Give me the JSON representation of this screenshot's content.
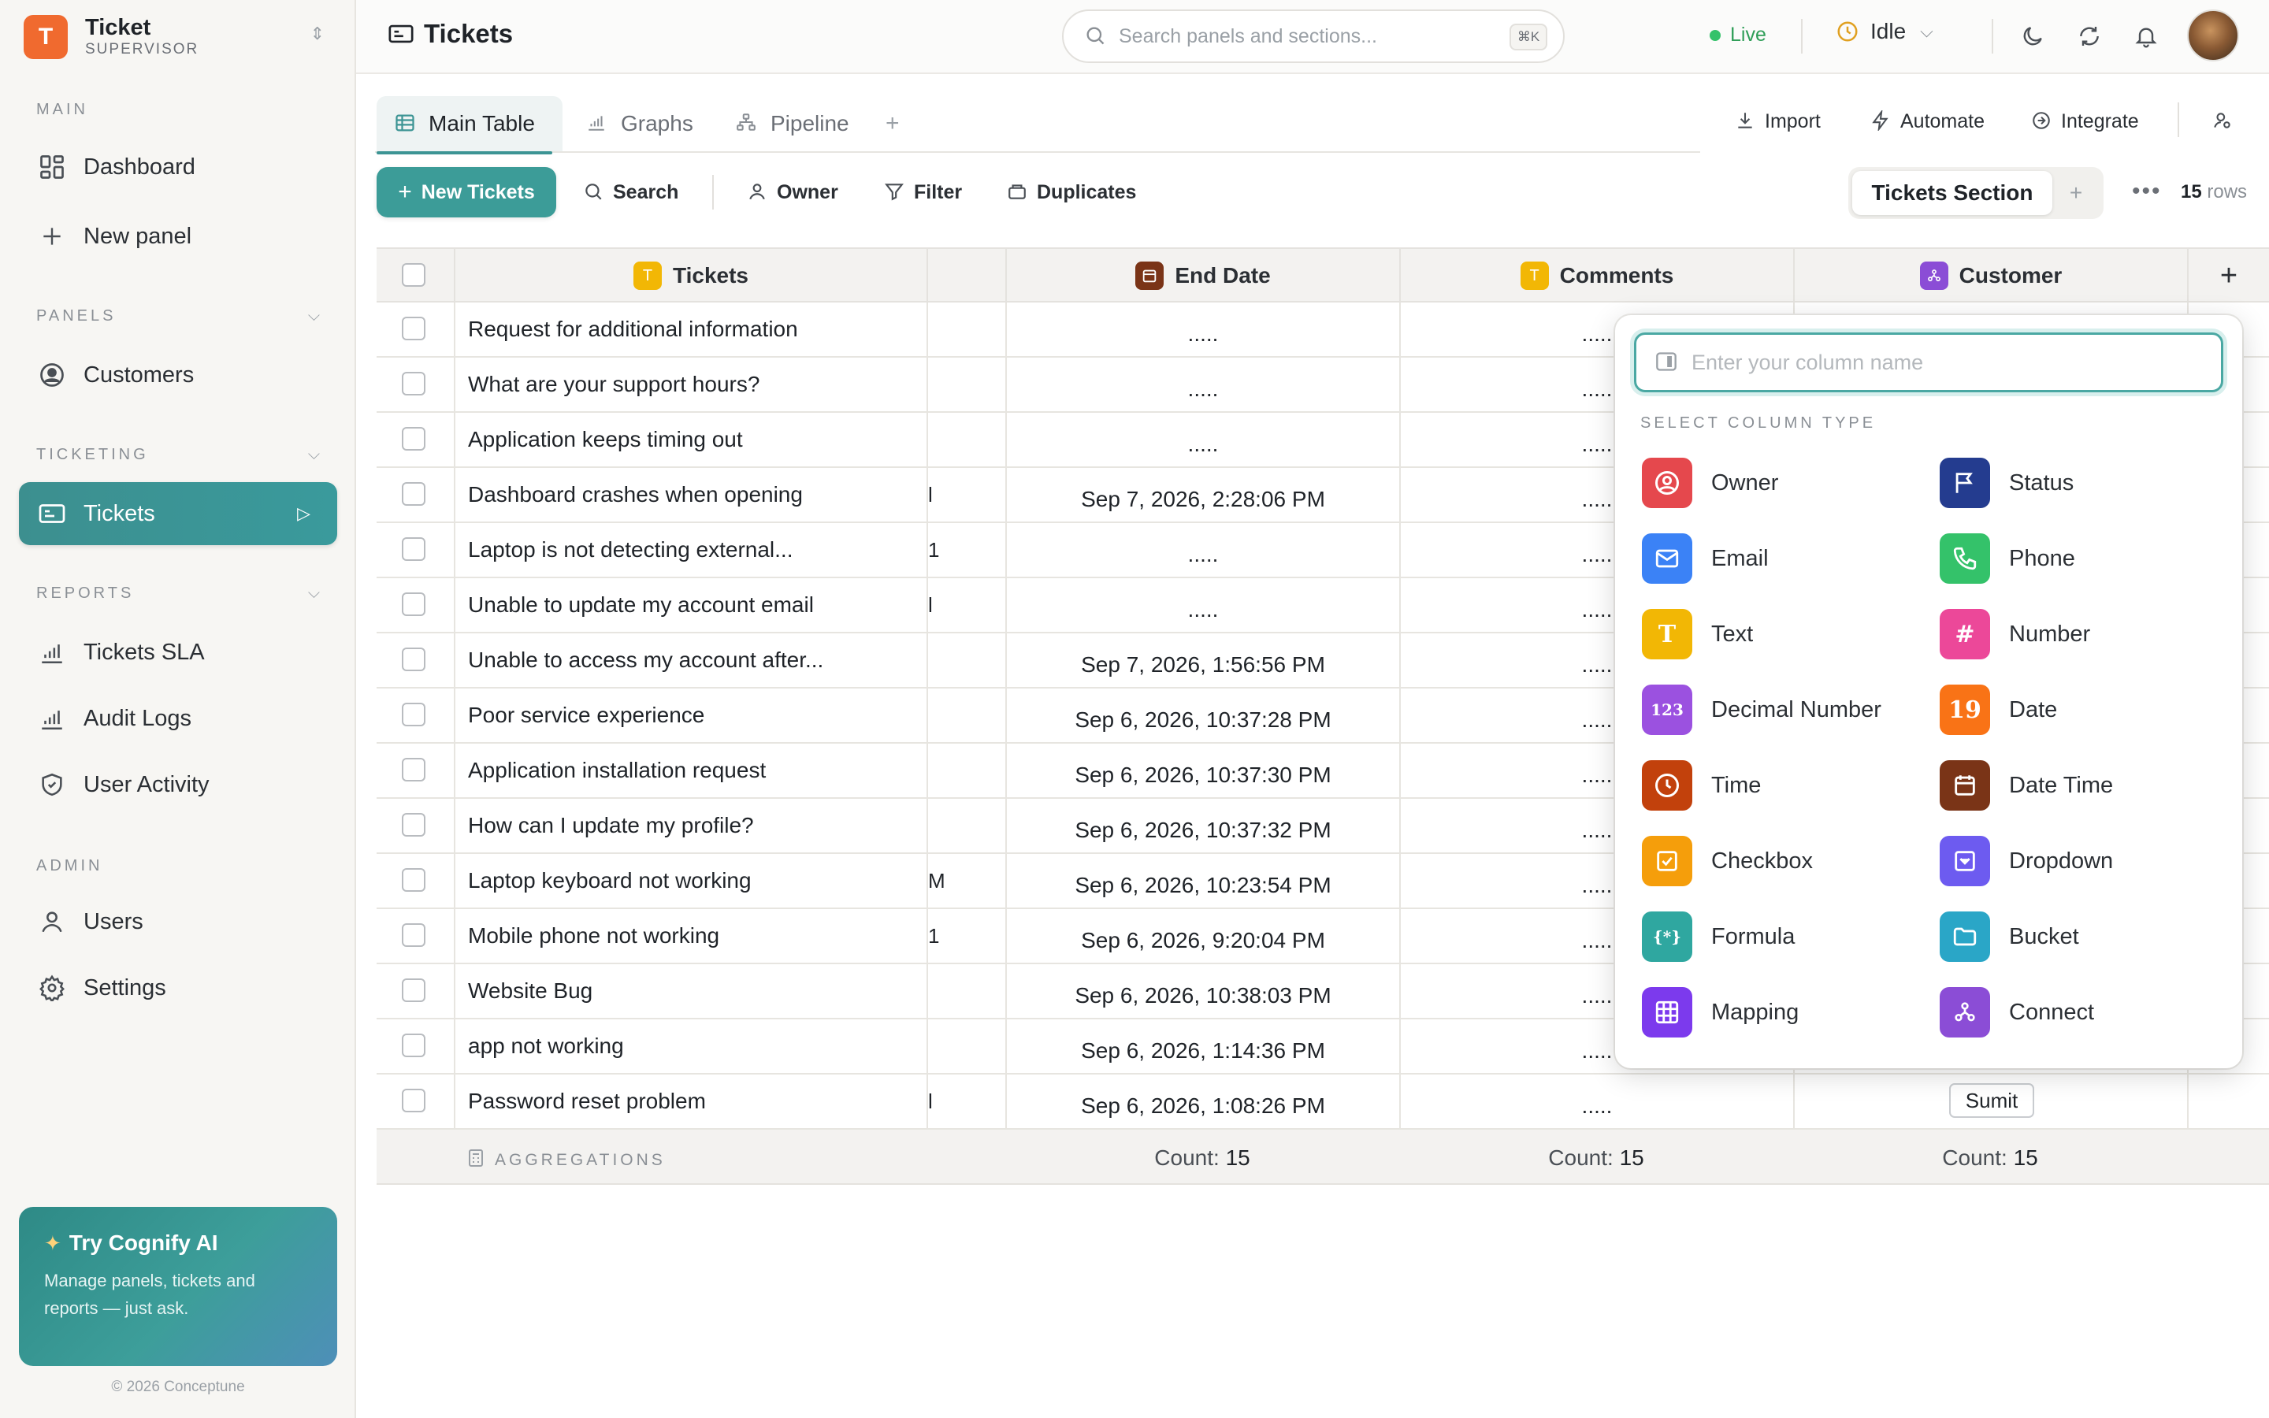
{
  "brand": {
    "logo_letter": "T",
    "title": "Ticket",
    "subtitle": "SUPERVISOR"
  },
  "sidebar": {
    "main_label": "MAIN",
    "main_items": [
      {
        "label": "Dashboard"
      },
      {
        "label": "New panel"
      }
    ],
    "panels_label": "PANELS",
    "panels_items": [
      {
        "label": "Customers"
      }
    ],
    "ticketing_label": "TICKETING",
    "ticketing_items": [
      {
        "label": "Tickets",
        "active": true
      }
    ],
    "reports_label": "REPORTS",
    "reports_items": [
      {
        "label": "Tickets SLA"
      },
      {
        "label": "Audit Logs"
      },
      {
        "label": "User Activity"
      }
    ],
    "admin_label": "ADMIN",
    "admin_items": [
      {
        "label": "Users"
      },
      {
        "label": "Settings"
      }
    ]
  },
  "promo": {
    "title": "Try Cognify AI",
    "body": "Manage panels, tickets and reports — just ask."
  },
  "footer": {
    "copyright": "© 2026 Conceptune"
  },
  "header": {
    "title": "Tickets",
    "search_placeholder": "Search panels and sections...",
    "search_shortcut": "⌘K",
    "live_label": "Live",
    "status_label": "Idle"
  },
  "tabs": [
    {
      "label": "Main Table"
    },
    {
      "label": "Graphs"
    },
    {
      "label": "Pipeline"
    }
  ],
  "actions": {
    "import": "Import",
    "automate": "Automate",
    "integrate": "Integrate"
  },
  "toolbar": {
    "new_label": "New Tickets",
    "search_label": "Search",
    "owner_label": "Owner",
    "filter_label": "Filter",
    "duplicates_label": "Duplicates",
    "section_label": "Tickets Section",
    "rows_count": "15",
    "rows_suffix": "rows"
  },
  "table": {
    "columns": [
      {
        "label": "Tickets",
        "badge": "T",
        "color": "#f2b705"
      },
      {
        "label": "End Date",
        "color": "#7a3417"
      },
      {
        "label": "Comments",
        "badge": "T",
        "color": "#f2b705"
      },
      {
        "label": "Customer",
        "color": "#8b4dd6"
      }
    ],
    "rows": [
      {
        "ticket": "Request for additional information",
        "frag": "",
        "end": ".....",
        "comment": "....."
      },
      {
        "ticket": "What are your support hours?",
        "frag": "",
        "end": ".....",
        "comment": "....."
      },
      {
        "ticket": "Application keeps timing out",
        "frag": "",
        "end": ".....",
        "comment": "....."
      },
      {
        "ticket": "Dashboard crashes when opening",
        "frag": "l",
        "end": "Sep 7, 2026, 2:28:06 PM",
        "comment": "....."
      },
      {
        "ticket": "Laptop is not detecting external...",
        "frag": "1",
        "end": ".....",
        "comment": "....."
      },
      {
        "ticket": "Unable to update my account email",
        "frag": "l",
        "end": ".....",
        "comment": "....."
      },
      {
        "ticket": "Unable to access my account after...",
        "frag": "",
        "end": "Sep 7, 2026, 1:56:56 PM",
        "comment": "....."
      },
      {
        "ticket": "Poor service experience",
        "frag": "",
        "end": "Sep 6, 2026, 10:37:28 PM",
        "comment": "....."
      },
      {
        "ticket": "Application installation request",
        "frag": "",
        "end": "Sep 6, 2026, 10:37:30 PM",
        "comment": "....."
      },
      {
        "ticket": "How can I update my profile?",
        "frag": "",
        "end": "Sep 6, 2026, 10:37:32 PM",
        "comment": "....."
      },
      {
        "ticket": "Laptop keyboard not working",
        "frag": "M",
        "end": "Sep 6, 2026, 10:23:54 PM",
        "comment": "....."
      },
      {
        "ticket": "Mobile phone not working",
        "frag": "1",
        "end": "Sep 6, 2026, 9:20:04 PM",
        "comment": "....."
      },
      {
        "ticket": "Website Bug",
        "frag": "",
        "end": "Sep 6, 2026, 10:38:03 PM",
        "comment": "....."
      },
      {
        "ticket": "app not working",
        "frag": "",
        "end": "Sep 6, 2026, 1:14:36 PM",
        "comment": "....."
      },
      {
        "ticket": "Password reset problem",
        "frag": "l",
        "end": "Sep 6, 2026, 1:08:26 PM",
        "comment": "....."
      }
    ],
    "sumit_label": "Sumit",
    "aggregations_label": "AGGREGATIONS",
    "count_label": "Count:",
    "count_value": "15"
  },
  "popover": {
    "input_placeholder": "Enter your column name",
    "section_label": "SELECT COLUMN TYPE",
    "options": [
      {
        "label": "Owner",
        "color": "#e5484d",
        "icon": "owner-icon"
      },
      {
        "label": "Status",
        "color": "#243c8f",
        "icon": "flag-icon"
      },
      {
        "label": "Email",
        "color": "#3b82f6",
        "icon": "mail-icon"
      },
      {
        "label": "Phone",
        "color": "#34c26a",
        "icon": "phone-icon"
      },
      {
        "label": "Text",
        "color": "#f2b705",
        "icon": "text-icon",
        "glyph": "T"
      },
      {
        "label": "Number",
        "color": "#ec4899",
        "icon": "hash-icon",
        "glyph": "#"
      },
      {
        "label": "Decimal Number",
        "color": "#9b51e0",
        "icon": "decimal-icon",
        "glyph": "123"
      },
      {
        "label": "Date",
        "color": "#f97316",
        "icon": "calendar-icon",
        "glyph": "19"
      },
      {
        "label": "Time",
        "color": "#c2410c",
        "icon": "clock-icon"
      },
      {
        "label": "Date Time",
        "color": "#7a3417",
        "icon": "datetime-icon"
      },
      {
        "label": "Checkbox",
        "color": "#f59e0b",
        "icon": "checkbox-icon"
      },
      {
        "label": "Dropdown",
        "color": "#6d5bf0",
        "icon": "dropdown-icon"
      },
      {
        "label": "Formula",
        "color": "#2fa7a0",
        "icon": "formula-icon",
        "glyph": "{*}"
      },
      {
        "label": "Bucket",
        "color": "#2aa6c7",
        "icon": "folder-icon"
      },
      {
        "label": "Mapping",
        "color": "#7c3aed",
        "icon": "grid-icon"
      },
      {
        "label": "Connect",
        "color": "#8b4dd6",
        "icon": "connect-icon"
      }
    ]
  }
}
